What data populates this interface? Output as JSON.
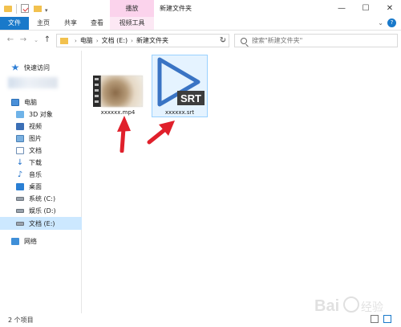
{
  "window": {
    "context_tab": "播放",
    "title": "新建文件夹",
    "minimize": "—",
    "maximize": "☐",
    "close": "✕"
  },
  "ribbon": {
    "tabs": [
      "文件",
      "主页",
      "共享",
      "查看",
      "视频工具"
    ]
  },
  "address": {
    "crumbs": [
      "电脑",
      "文档 (E:)",
      "新建文件夹"
    ],
    "search_placeholder": "搜索\"新建文件夹\""
  },
  "nav": {
    "quick_access": "快速访问",
    "this_pc": "电脑",
    "items": [
      "3D 对象",
      "视频",
      "图片",
      "文档",
      "下载",
      "音乐",
      "桌面",
      "系统 (C:)",
      "娱乐 (D:)",
      "文档 (E:)"
    ],
    "network": "网络"
  },
  "files": [
    {
      "name": "xxxxxx.mp4",
      "type": "video"
    },
    {
      "name": "xxxxxx.srt",
      "type": "subtitle",
      "badge": "SRT"
    }
  ],
  "status": {
    "count": "2 个项目"
  },
  "colors": {
    "accent": "#1979ca",
    "context_tab": "#fbd3ec",
    "selection": "#cce8ff",
    "arrow": "#e0202b",
    "srt_play": "#3a74c4"
  },
  "watermark": "Baidu经验"
}
